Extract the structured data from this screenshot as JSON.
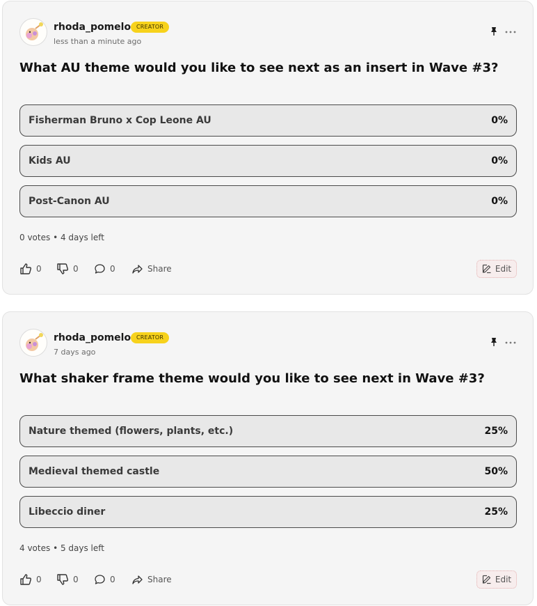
{
  "posts": [
    {
      "username": "rhoda_pomelo",
      "badge": "CREATOR",
      "timestamp": "less than a minute ago",
      "question": "What AU theme would you like to see next as an insert in Wave #3?",
      "options": [
        {
          "label": "Fisherman Bruno x Cop Leone AU",
          "percent": "0%"
        },
        {
          "label": "Kids AU",
          "percent": "0%"
        },
        {
          "label": "Post-Canon AU",
          "percent": "0%"
        }
      ],
      "votes": "0 votes",
      "separator": "•",
      "time_left": "4 days left",
      "likes": "0",
      "dislikes": "0",
      "comments": "0",
      "share_label": "Share",
      "edit_label": "Edit"
    },
    {
      "username": "rhoda_pomelo",
      "badge": "CREATOR",
      "timestamp": "7 days ago",
      "question": "What shaker frame theme would you like to see next in Wave #3?",
      "options": [
        {
          "label": "Nature themed (flowers, plants, etc.)",
          "percent": "25%"
        },
        {
          "label": "Medieval themed castle",
          "percent": "50%"
        },
        {
          "label": "Libeccio diner",
          "percent": "25%"
        }
      ],
      "votes": "4 votes",
      "separator": "•",
      "time_left": "5 days left",
      "likes": "0",
      "dislikes": "0",
      "comments": "0",
      "share_label": "Share",
      "edit_label": "Edit"
    }
  ],
  "colors": {
    "badge": "#f7d21c",
    "card": "#f5f5f5",
    "option_bg": "#e8e8e8",
    "option_border": "#4a4a4a"
  }
}
